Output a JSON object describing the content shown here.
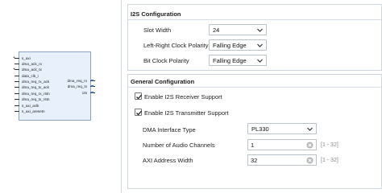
{
  "symbol": {
    "left_ports": [
      "s_axi",
      "dma_ack_rx",
      "dma_ack_tx",
      "data_clk_i",
      "dma_req_rx_ack",
      "dma_req_tx_ack",
      "dma_req_rx_rstn",
      "dma_req_tx_rstn",
      "s_axi_aclk",
      "s_axi_aresetn"
    ],
    "right_ports": [
      "dma_req_rx",
      "dma_req_tx",
      "i2s"
    ]
  },
  "i2s_config": {
    "title": "I2S Configuration",
    "slot_width_label": "Slot Width",
    "slot_width_value": "24",
    "lr_clock_polarity_label": "Left-Right Clock Polarity",
    "lr_clock_polarity_value": "Falling Edge",
    "bit_clock_polarity_label": "Bit Clock Polarity",
    "bit_clock_polarity_value": "Falling Edge"
  },
  "general_config": {
    "title": "General Configuration",
    "enable_rx_label": "Enable I2S Receiver Support",
    "enable_rx_checked": true,
    "enable_tx_label": "Enable I2S Transmitter Support",
    "enable_tx_checked": true,
    "dma_interface_label": "DMA Interface Type",
    "dma_interface_value": "PL330",
    "num_channels_label": "Number of Audio Channels",
    "num_channels_value": "1",
    "num_channels_range": "[1 - 32]",
    "axi_addr_width_label": "AXI Address Width",
    "axi_addr_width_value": "32",
    "axi_addr_width_range": "[1 - 32]"
  },
  "colors": {
    "symbol_fill": "#e8f0fb",
    "symbol_border": "#8da4c2",
    "frame_border": "#cfd6de"
  }
}
